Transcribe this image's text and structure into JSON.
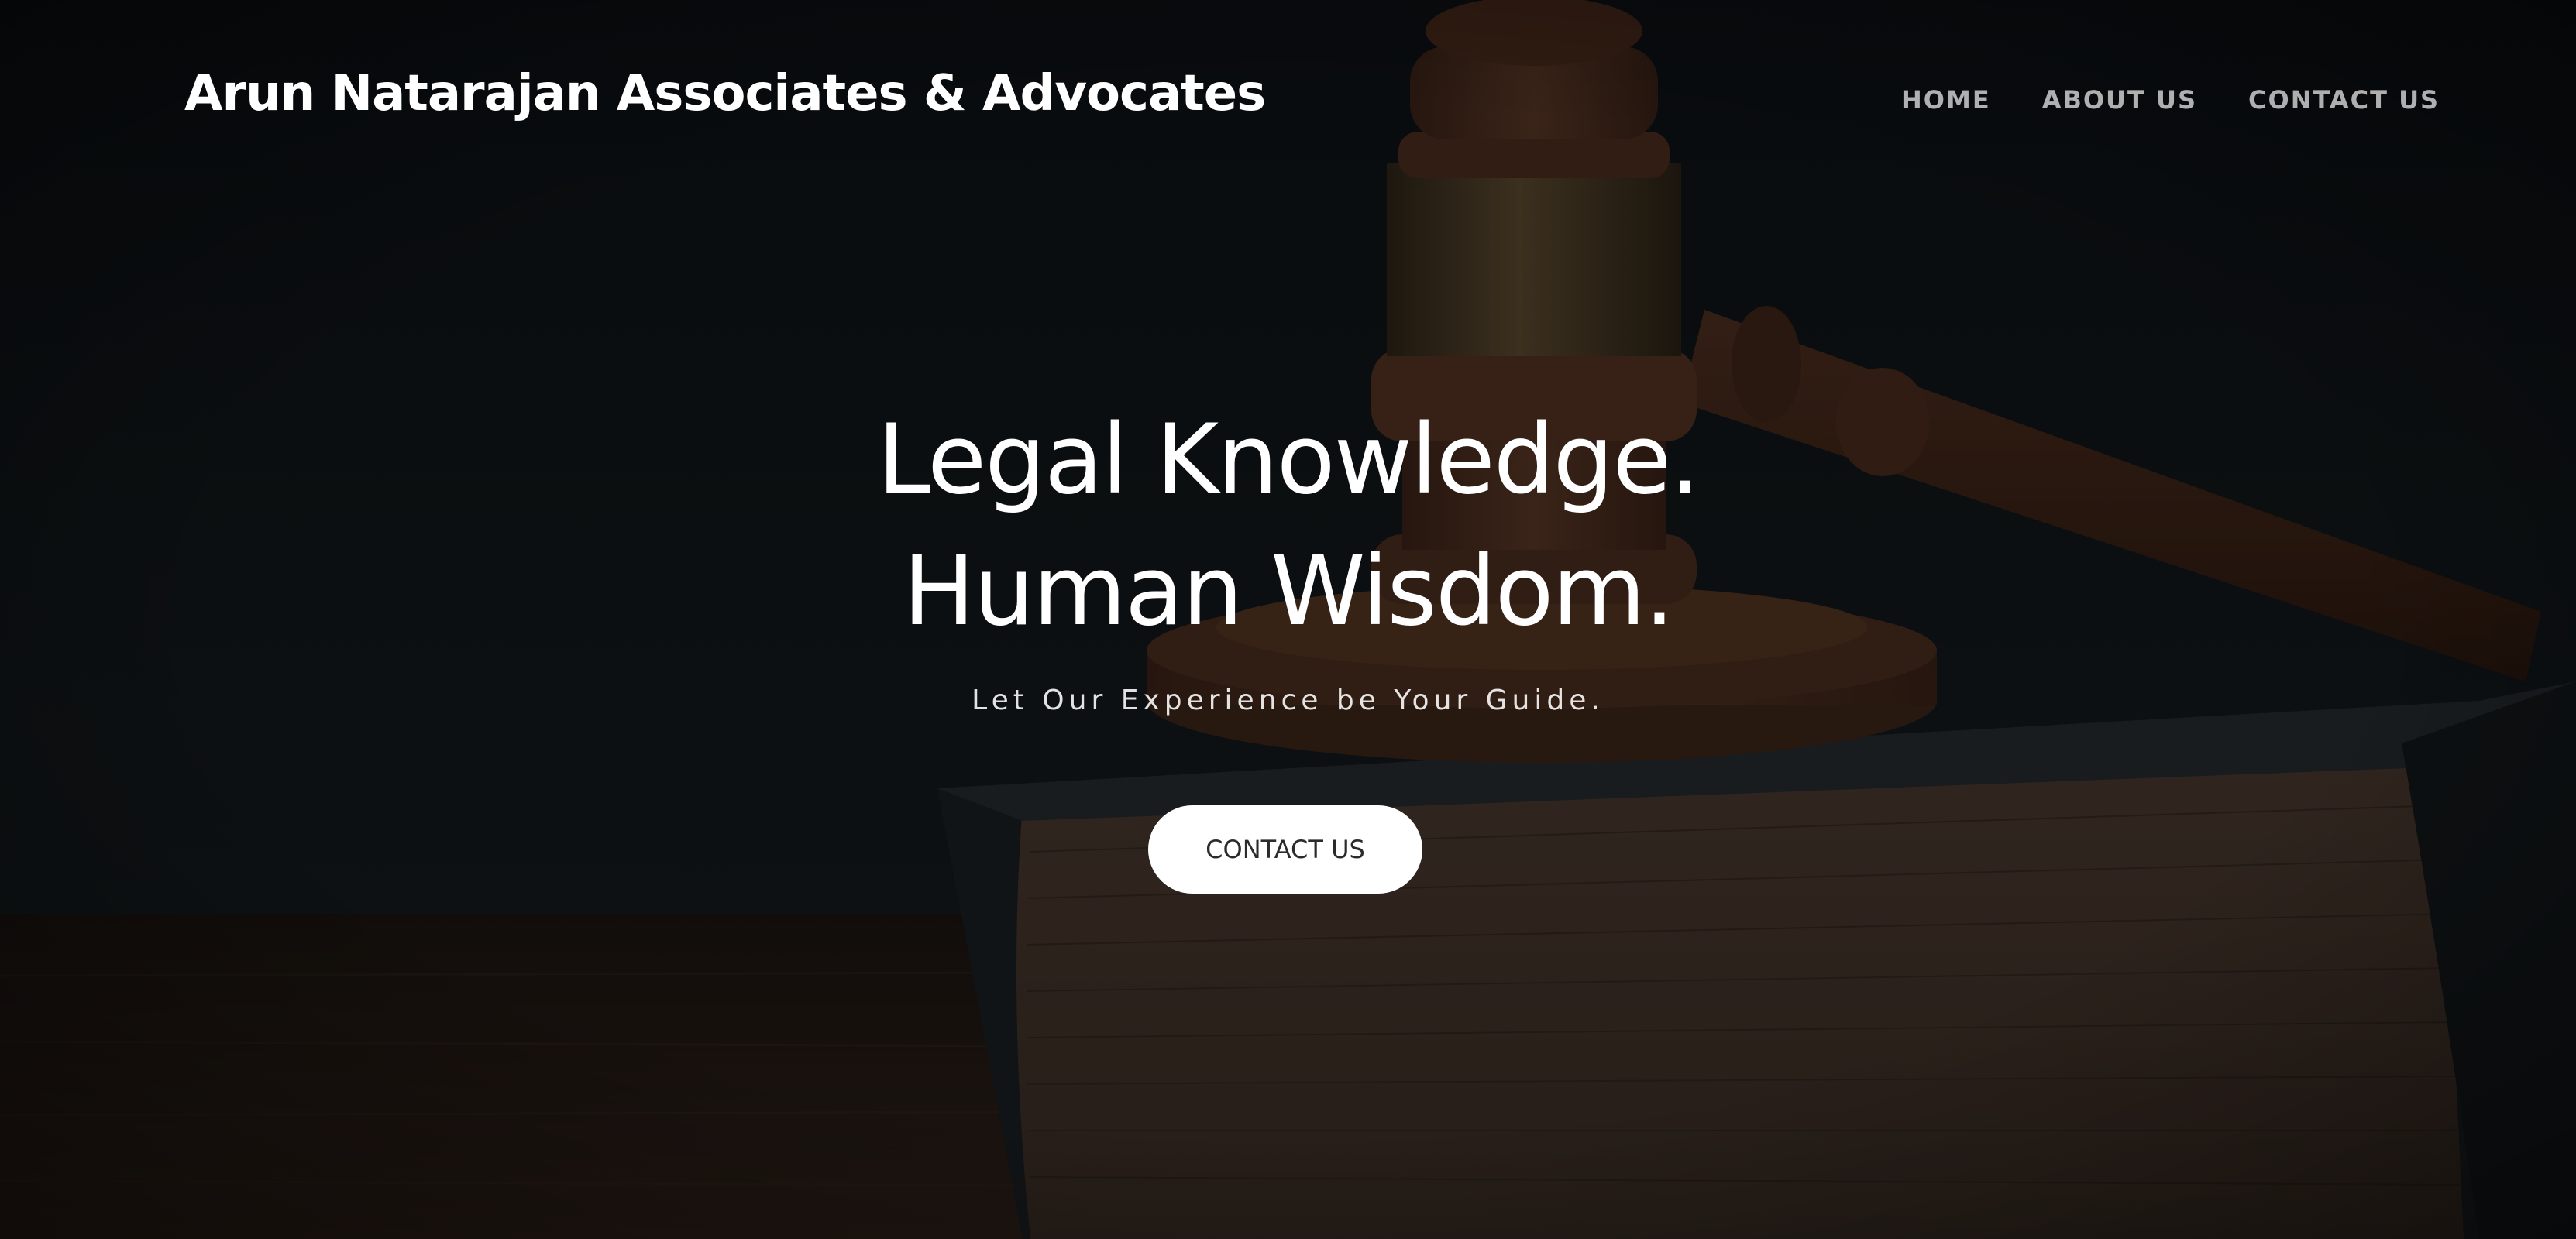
{
  "navbar": {
    "brand": "Arun Natarajan Associates & Advocates",
    "links": [
      {
        "label": "HOME"
      },
      {
        "label": "ABOUT US"
      },
      {
        "label": "CONTACT US"
      }
    ]
  },
  "hero": {
    "headline_line1": "Legal Knowledge.",
    "headline_line2": "Human Wisdom.",
    "subheading": "Let Our Experience be Your Guide.",
    "cta_label": "CONTACT US",
    "background_image": "gavel-on-book-icon"
  },
  "colors": {
    "background": "#0d1114",
    "text": "#ffffff",
    "cta_background": "#ffffff",
    "cta_text": "#2b2b2b"
  }
}
